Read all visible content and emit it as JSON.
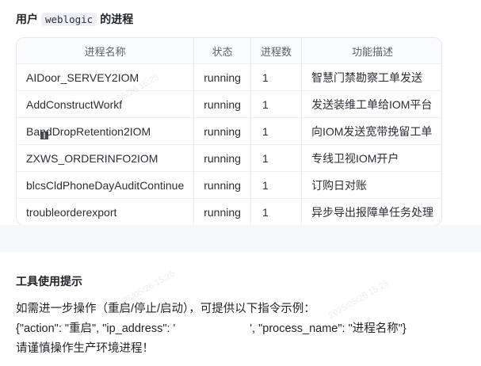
{
  "header": {
    "title_prefix": "用户",
    "title_user": "weblogic",
    "title_suffix": "的进程"
  },
  "table": {
    "columns": [
      "进程名称",
      "状态",
      "进程数",
      "功能描述"
    ],
    "rows": [
      {
        "name": "AIDoor_SERVEY2IOM",
        "status": "running",
        "count": "1",
        "desc": "智慧门禁勘察工单发送"
      },
      {
        "name": "AddConstructWorkf",
        "status": "running",
        "count": "1",
        "desc": "发送装维工单给IOM平台"
      },
      {
        "name": "BandDropRetention2IOM",
        "status": "running",
        "count": "1",
        "desc": "向IOM发送宽带挽留工单"
      },
      {
        "name": "ZXWS_ORDERINFO2IOM",
        "status": "running",
        "count": "1",
        "desc": "专线卫视IOM开户"
      },
      {
        "name": "blcsCldPhoneDayAuditContinue",
        "status": "running",
        "count": "1",
        "desc": "订购日对账"
      },
      {
        "name": "troubleorderexport",
        "status": "running",
        "count": "1",
        "desc": "异步导出报障单任务处理"
      }
    ]
  },
  "tips": {
    "title": "工具使用提示",
    "line1": "如需进一步操作（重启/停止/启动），可提供以下指令示例：",
    "line2_a": "{\"action\": \"重启\", \"ip_address\": '",
    "line2_b": "', \"process_name\": \"进程名称\"}",
    "line3": "请谨慎操作生产环境进程！"
  },
  "watermark": "2025/05/26 15:25",
  "colors": {
    "border": "#e6e8eb",
    "text": "#1f2328",
    "muted": "#5b6068",
    "band": "#f7f8fa"
  },
  "icons": {
    "cursor": "i-beam-cursor-icon"
  }
}
